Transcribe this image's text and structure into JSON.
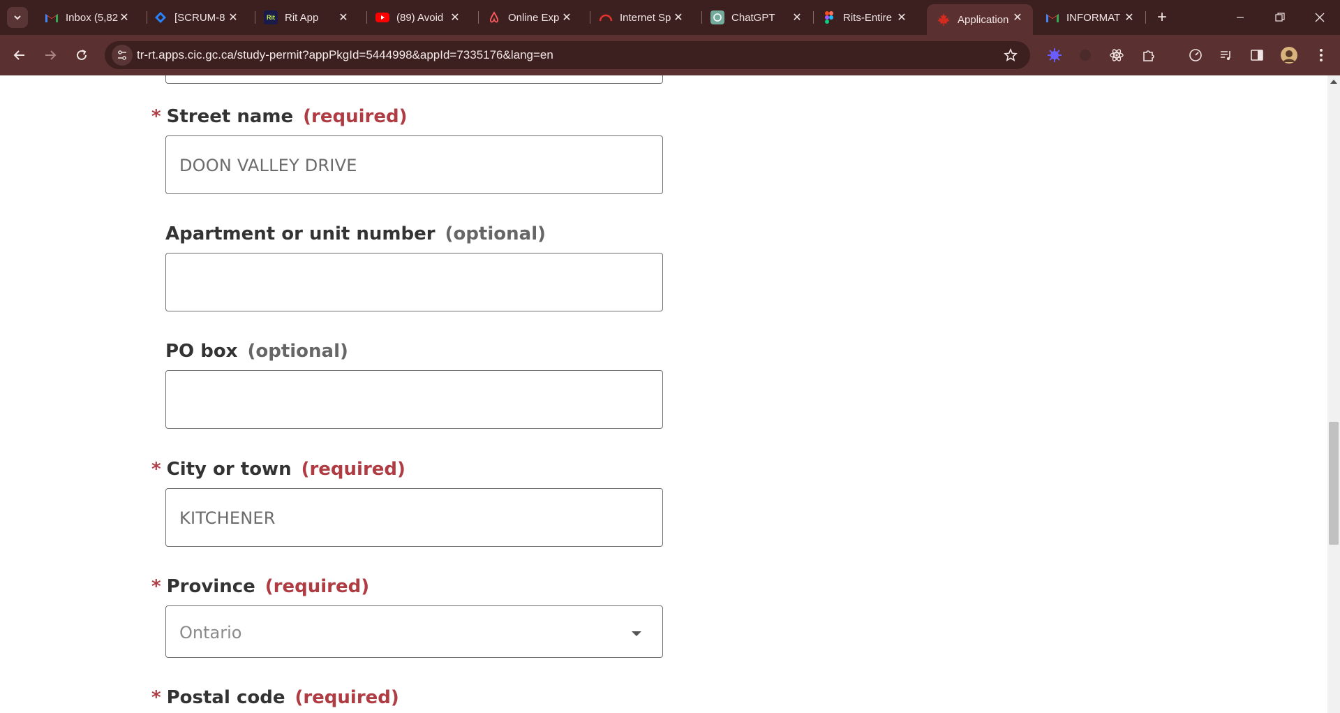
{
  "browser": {
    "tabs": [
      {
        "title": "Inbox (5,82",
        "icon": "gmail-icon"
      },
      {
        "title": "[SCRUM-8",
        "icon": "jira-icon"
      },
      {
        "title": "Rit App",
        "icon": "rit-icon",
        "icon_text": "Rit"
      },
      {
        "title": "(89) Avoid",
        "icon": "youtube-icon"
      },
      {
        "title": "Online Exp",
        "icon": "airbnb-icon"
      },
      {
        "title": "Internet Sp",
        "icon": "speedtest-icon"
      },
      {
        "title": "ChatGPT",
        "icon": "chatgpt-icon"
      },
      {
        "title": "Rits-Entire",
        "icon": "figma-icon"
      },
      {
        "title": "Application",
        "icon": "maple-leaf-icon",
        "active": true
      },
      {
        "title": "INFORMAT",
        "icon": "gmail-icon"
      }
    ],
    "url": "tr-rt.apps.cic.gc.ca/study-permit?appPkgId=5444998&appId=7335176&lang=en"
  },
  "form": {
    "street_name": {
      "label": "Street name",
      "tag": "(required)",
      "value": "DOON VALLEY DRIVE"
    },
    "apartment": {
      "label": "Apartment or unit number",
      "tag": "(optional)",
      "value": ""
    },
    "po_box": {
      "label": "PO box",
      "tag": "(optional)",
      "value": ""
    },
    "city": {
      "label": "City or town",
      "tag": "(required)",
      "value": "KITCHENER"
    },
    "province": {
      "label": "Province",
      "tag": "(required)",
      "value": "Ontario"
    },
    "postal_code": {
      "label": "Postal code",
      "tag": "(required)"
    },
    "required_marker": "*"
  },
  "colors": {
    "required": "#af3c43",
    "chrome_dark": "#3c1f1f",
    "chrome_toolbar": "#5a3030"
  }
}
